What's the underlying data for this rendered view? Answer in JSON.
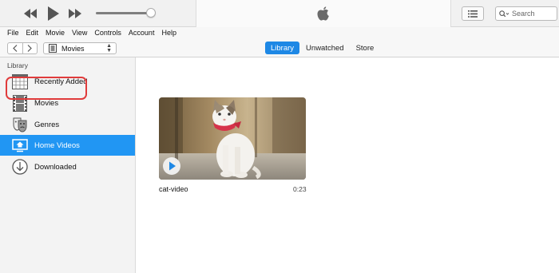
{
  "player": {
    "rewind_icon": "rewind-icon",
    "play_icon": "play-icon",
    "forward_icon": "fast-forward-icon",
    "volume": 0.92,
    "logo_icon": "apple-logo-icon",
    "list_icon": "list-view-icon",
    "search_placeholder": "Search"
  },
  "menu": [
    "File",
    "Edit",
    "Movie",
    "View",
    "Controls",
    "Account",
    "Help"
  ],
  "nav": {
    "media_kind": "Movies",
    "tabs": [
      {
        "label": "Library",
        "active": true
      },
      {
        "label": "Unwatched",
        "active": false
      },
      {
        "label": "Store",
        "active": false
      }
    ]
  },
  "sidebar": {
    "header": "Library",
    "items": [
      {
        "label": "Recently Added",
        "icon": "calendar-grid-icon"
      },
      {
        "label": "Movies",
        "icon": "film-strip-icon"
      },
      {
        "label": "Genres",
        "icon": "theater-masks-icon"
      },
      {
        "label": "Home Videos",
        "icon": "home-video-icon",
        "selected": true
      },
      {
        "label": "Downloaded",
        "icon": "download-circle-icon"
      }
    ]
  },
  "video": {
    "title": "cat-video",
    "duration": "0:23"
  },
  "colors": {
    "accent": "#2196f3",
    "highlight_border": "#e03b3b"
  }
}
